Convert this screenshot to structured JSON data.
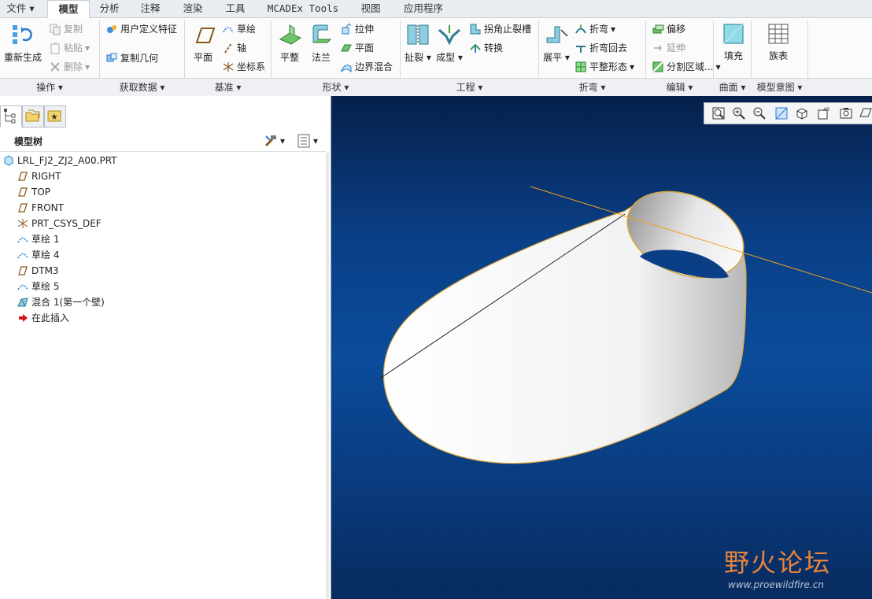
{
  "menu": {
    "file": "文件",
    "tabs": [
      "模型",
      "分析",
      "注释",
      "渲染",
      "工具",
      "MCADEx Tools",
      "视图",
      "应用程序"
    ]
  },
  "ribbon": {
    "regen": "重新生成",
    "copy": "复制",
    "paste": "粘贴",
    "delete": "删除",
    "udf": "用户定义特征",
    "copy_geom": "复制几何",
    "plane": "平面",
    "sketch": "草绘",
    "axis": "轴",
    "csys": "坐标系",
    "flat": "平整",
    "flange": "法兰",
    "extrude": "拉伸",
    "plane2": "平面",
    "boundary_blend": "边界混合",
    "rip": "扯裂",
    "form": "成型",
    "corner_relief": "拐角止裂槽",
    "convert": "转换",
    "unbend": "展平",
    "bend": "折弯",
    "bend_back": "折弯回去",
    "flat_pattern": "平整形态",
    "offset": "偏移",
    "extend": "延伸",
    "split_area": "分割区域...",
    "fill": "填充",
    "family_table": "族表"
  },
  "groups": {
    "operations": "操作",
    "get_data": "获取数据",
    "datum": "基准",
    "shapes": "形状",
    "engineering": "工程",
    "bends": "折弯",
    "editing": "编辑",
    "surfaces": "曲面",
    "model_intent": "模型意图"
  },
  "tree": {
    "title": "模型树",
    "items": [
      {
        "label": "LRL_FJ2_ZJ2_A00.PRT",
        "icon": "part-icon"
      },
      {
        "label": "RIGHT",
        "icon": "datum-plane-icon"
      },
      {
        "label": "TOP",
        "icon": "datum-plane-icon"
      },
      {
        "label": "FRONT",
        "icon": "datum-plane-icon"
      },
      {
        "label": "PRT_CSYS_DEF",
        "icon": "csys-icon"
      },
      {
        "label": "草绘 1",
        "icon": "sketch-icon"
      },
      {
        "label": "草绘 4",
        "icon": "sketch-icon"
      },
      {
        "label": "DTM3",
        "icon": "datum-plane-icon"
      },
      {
        "label": "草绘 5",
        "icon": "sketch-icon"
      },
      {
        "label": "混合 1(第一个壁)",
        "icon": "blend-wall-icon"
      },
      {
        "label": "在此插入",
        "icon": "insert-arrow-icon"
      }
    ]
  },
  "watermark": {
    "cn": "野火论坛",
    "url": "www.proewildfire.cn"
  },
  "colors": {
    "accent": "#2b7fd6",
    "viewport_top": "#06204b",
    "viewport_mid": "#0b4c9b",
    "datum_axis": "#f0a020",
    "watermark": "#e8833a"
  }
}
